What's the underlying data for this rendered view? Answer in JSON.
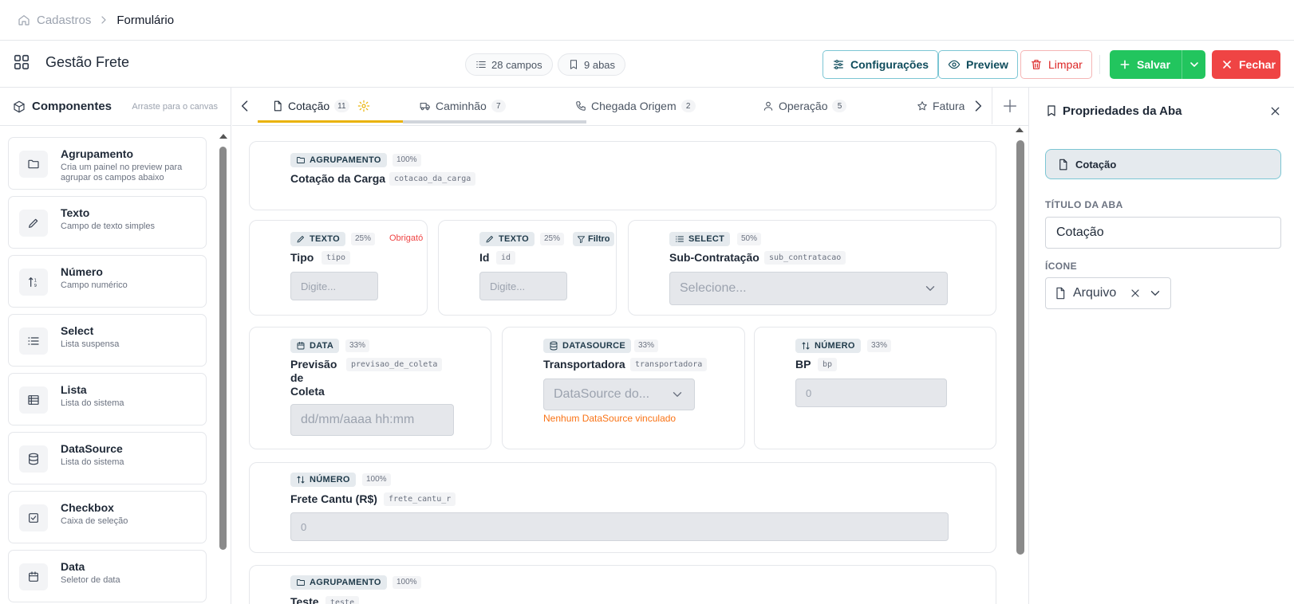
{
  "breadcrumb": {
    "parent": "Cadastros",
    "current": "Formulário"
  },
  "header": {
    "title": "Gestão Frete",
    "fields_count": "28 campos",
    "tabs_count": "9 abas",
    "config_label": "Configurações",
    "preview_label": "Preview",
    "clear_label": "Limpar",
    "save_label": "Salvar",
    "close_label": "Fechar"
  },
  "sidebar": {
    "title": "Componentes",
    "hint": "Arraste para o canvas",
    "items": [
      {
        "name": "Agrupamento",
        "desc": "Cria um painel no preview para agrupar os campos abaixo",
        "icon": "folder-icon"
      },
      {
        "name": "Texto",
        "desc": "Campo de texto simples",
        "icon": "pencil-icon"
      },
      {
        "name": "Número",
        "desc": "Campo numérico",
        "icon": "sort-numeric-icon"
      },
      {
        "name": "Select",
        "desc": "Lista suspensa",
        "icon": "list-icon"
      },
      {
        "name": "Lista",
        "desc": "Lista do sistema",
        "icon": "table-list-icon"
      },
      {
        "name": "DataSource",
        "desc": "Lista do sistema",
        "icon": "database-icon"
      },
      {
        "name": "Checkbox",
        "desc": "Caixa de seleção",
        "icon": "checkbox-icon"
      },
      {
        "name": "Data",
        "desc": "Seletor de data",
        "icon": "calendar-icon"
      }
    ]
  },
  "tabs": [
    {
      "label": "Cotação",
      "count": "11",
      "icon": "file-icon"
    },
    {
      "label": "Caminhão",
      "count": "7",
      "icon": "truck-icon"
    },
    {
      "label": "Chegada Origem",
      "count": "2",
      "icon": "phone-icon"
    },
    {
      "label": "Operação",
      "count": "5",
      "icon": "user-icon"
    },
    {
      "label": "Faturar",
      "icon": "star-icon"
    }
  ],
  "canvas": {
    "group1": {
      "type": "AGRUPAMENTO",
      "width": "100%",
      "label": "Cotação da Carga",
      "key": "cotacao_da_carga"
    },
    "tipo": {
      "type": "TEXTO",
      "width": "25%",
      "required": "Obrigató",
      "label": "Tipo",
      "key": "tipo",
      "placeholder": "Digite..."
    },
    "id": {
      "type": "TEXTO",
      "width": "25%",
      "filter": "Filtro",
      "label": "Id",
      "key": "id",
      "placeholder": "Digite..."
    },
    "sub": {
      "type": "SELECT",
      "width": "50%",
      "label": "Sub-Contratação",
      "key": "sub_contratacao",
      "placeholder": "Selecione..."
    },
    "previsao": {
      "type": "DATA",
      "width": "33%",
      "label_l1": "Previsão",
      "label_l2": "de",
      "label_l3": "Coleta",
      "key": "previsao_de_coleta",
      "placeholder": "dd/mm/aaaa hh:mm"
    },
    "transp": {
      "type": "DATASOURCE",
      "width": "33%",
      "label": "Transportadora",
      "key": "transportadora",
      "placeholder": "DataSource do...",
      "warning": "Nenhum DataSource vinculado"
    },
    "bp": {
      "type": "NÚMERO",
      "width": "33%",
      "label": "BP",
      "key": "bp",
      "value": "0"
    },
    "frete": {
      "type": "NÚMERO",
      "width": "100%",
      "label": "Frete Cantu (R$)",
      "key": "frete_cantu_r",
      "value": "0"
    },
    "group2": {
      "type": "AGRUPAMENTO",
      "width": "100%",
      "label": "Teste",
      "key": "teste"
    }
  },
  "panel": {
    "title": "Propriedades da Aba",
    "selected_tab": "Cotação",
    "title_section": "TÍTULO DA ABA",
    "title_value": "Cotação",
    "icon_section": "ÍCONE",
    "icon_value": "Arquivo"
  }
}
